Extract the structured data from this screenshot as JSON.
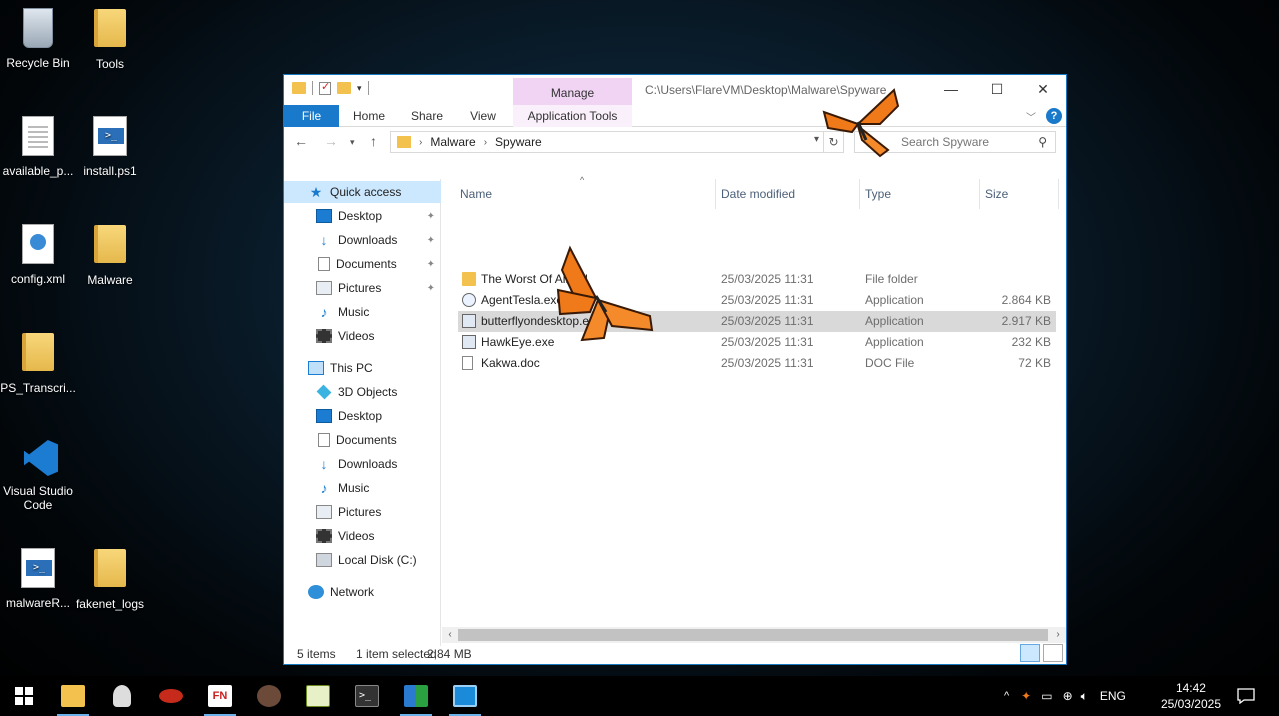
{
  "desktop": {
    "icons": [
      {
        "label": "Recycle Bin"
      },
      {
        "label": "Tools"
      },
      {
        "label": "available_p..."
      },
      {
        "label": "install.ps1"
      },
      {
        "label": "config.xml"
      },
      {
        "label": "Malware"
      },
      {
        "label": "PS_Transcri..."
      },
      {
        "label": "Visual Studio Code"
      },
      {
        "label": "malwareR..."
      },
      {
        "label": "fakenet_logs"
      }
    ]
  },
  "window": {
    "title_path": "C:\\Users\\FlareVM\\Desktop\\Malware\\Spyware",
    "manage_tab": "Manage",
    "ribbon_tabs": {
      "file": "File",
      "home": "Home",
      "share": "Share",
      "view": "View",
      "app_tools": "Application Tools"
    },
    "controls": {
      "minimize": "—",
      "maximize": "☐",
      "close": "✕"
    },
    "breadcrumb": [
      "Malware",
      "Spyware"
    ],
    "search_placeholder": "Search Spyware",
    "nav": {
      "quick_access": "Quick access",
      "quick_items": [
        "Desktop",
        "Downloads",
        "Documents",
        "Pictures",
        "Music",
        "Videos"
      ],
      "this_pc": "This PC",
      "pc_items": [
        "3D Objects",
        "Desktop",
        "Documents",
        "Downloads",
        "Music",
        "Pictures",
        "Videos",
        "Local Disk (C:)"
      ],
      "network": "Network"
    },
    "columns": {
      "name": "Name",
      "date": "Date modified",
      "type": "Type",
      "size": "Size"
    },
    "files": [
      {
        "name": "The Worst Of All!!!!!!",
        "date": "25/03/2025 11:31",
        "type": "File folder",
        "size": "",
        "icon": "folder-icon"
      },
      {
        "name": "AgentTesla.exe",
        "date": "25/03/2025 11:31",
        "type": "Application",
        "size": "2.864 KB",
        "icon": "app-icon"
      },
      {
        "name": "butterflyondesktop.exe",
        "date": "25/03/2025 11:31",
        "type": "Application",
        "size": "2.917 KB",
        "icon": "exe-icon",
        "selected": true
      },
      {
        "name": "HawkEye.exe",
        "date": "25/03/2025 11:31",
        "type": "Application",
        "size": "232 KB",
        "icon": "exe-icon"
      },
      {
        "name": "Kakwa.doc",
        "date": "25/03/2025 11:31",
        "type": "DOC File",
        "size": "72 KB",
        "icon": "doc-icon"
      }
    ],
    "status": {
      "count": "5 items",
      "selection": "1 item selected",
      "sel_size": "2,84 MB"
    }
  },
  "taskbar": {
    "language": "ENG",
    "time": "14:42",
    "date": "25/03/2025",
    "fn_label": "FN"
  },
  "colors": {
    "accent": "#1979ca",
    "selected_row": "#d9d9d9",
    "nav_selected": "#cce8ff",
    "manage_tab": "#f1d3f4",
    "butterfly": "#f07a1a"
  }
}
